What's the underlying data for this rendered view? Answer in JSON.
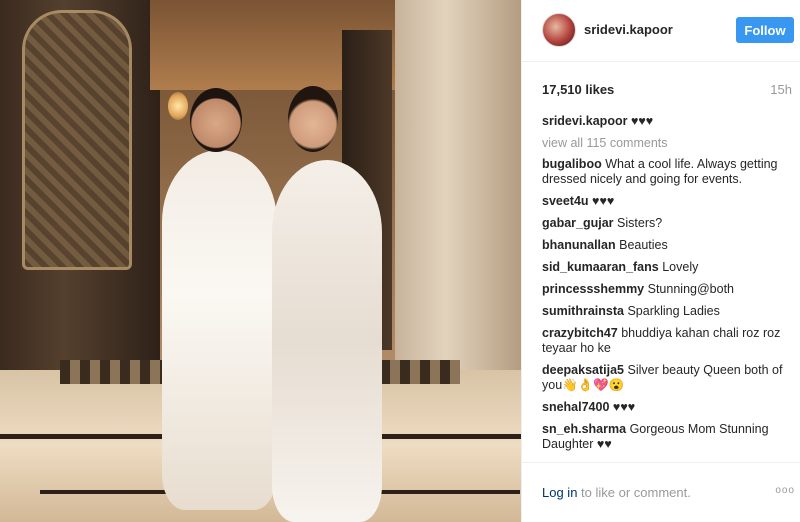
{
  "post": {
    "username": "sridevi.kapoor",
    "follow_label": "Follow",
    "likes": "17,510 likes",
    "time": "15h"
  },
  "caption": {
    "username": "sridevi.kapoor",
    "text": "♥♥♥"
  },
  "view_all": "view all 115 comments",
  "comments": [
    {
      "user": "bugaliboo",
      "text": "What a cool life. Always getting dressed nicely and going for events."
    },
    {
      "user": "sveet4u",
      "text": "♥♥♥"
    },
    {
      "user": "gabar_gujar",
      "text": "Sisters?"
    },
    {
      "user": "bhanunallan",
      "text": "Beauties"
    },
    {
      "user": "sid_kumaaran_fans",
      "text": "Lovely"
    },
    {
      "user": "princessshemmy",
      "text": "Stunning@both"
    },
    {
      "user": "sumithrainsta",
      "text": "Sparkling Ladies"
    },
    {
      "user": "crazybitch47",
      "text": "bhuddiya kahan chali roz roz teyaar ho ke"
    },
    {
      "user": "deepaksatija5",
      "text": "Silver beauty Queen both of you👋👌💖😮"
    },
    {
      "user": "snehal7400",
      "text": "♥♥♥"
    },
    {
      "user": "sn_eh.sharma",
      "text": "Gorgeous Mom Stunning Daughter ♥♥"
    }
  ],
  "footer": {
    "login_link": "Log in",
    "login_text": " to like or comment.",
    "more": "ooo"
  }
}
